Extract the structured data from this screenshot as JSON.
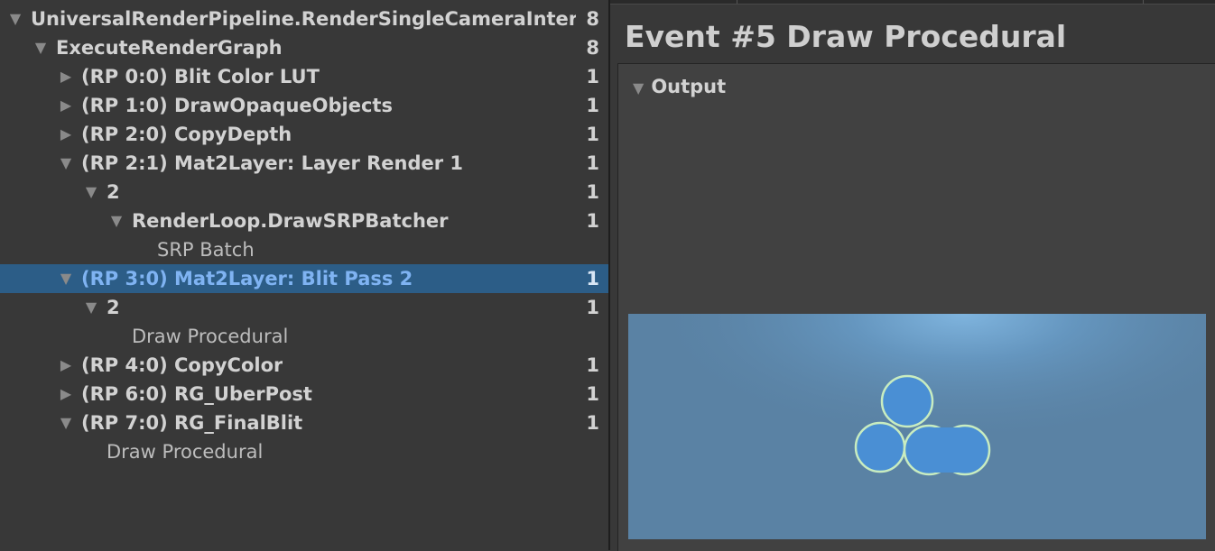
{
  "hierarchy": {
    "rows": [
      {
        "label": "UniversalRenderPipeline.RenderSingleCameraInter",
        "count": "8"
      },
      {
        "label": "ExecuteRenderGraph",
        "count": "8"
      },
      {
        "label": "(RP 0:0) Blit Color LUT",
        "count": "1"
      },
      {
        "label": "(RP 1:0) DrawOpaqueObjects",
        "count": "1"
      },
      {
        "label": "(RP 2:0) CopyDepth",
        "count": "1"
      },
      {
        "label": "(RP 2:1) Mat2Layer: Layer Render 1",
        "count": "1"
      },
      {
        "label": "2",
        "count": "1"
      },
      {
        "label": "RenderLoop.DrawSRPBatcher",
        "count": "1"
      },
      {
        "label": "SRP Batch",
        "count": ""
      },
      {
        "label": "(RP 3:0) Mat2Layer: Blit Pass 2",
        "count": "1"
      },
      {
        "label": "2",
        "count": "1"
      },
      {
        "label": "Draw Procedural",
        "count": ""
      },
      {
        "label": "(RP 4:0) CopyColor",
        "count": "1"
      },
      {
        "label": "(RP 6:0) RG_UberPost",
        "count": "1"
      },
      {
        "label": "(RP 7:0) RG_FinalBlit",
        "count": "1"
      },
      {
        "label": "Draw Procedural",
        "count": ""
      }
    ]
  },
  "details": {
    "title": "Event #5 Draw Procedural",
    "output_label": "Output"
  },
  "icons": {
    "expanded": "triangle-down-icon",
    "collapsed": "triangle-right-icon"
  },
  "colors": {
    "selection": "#2c5d87",
    "selected_text": "#7fb3f2",
    "preview_bg": "#5a82a4",
    "circle_fill": "#4a8fd4",
    "circle_outline": "#c8ecc0"
  }
}
